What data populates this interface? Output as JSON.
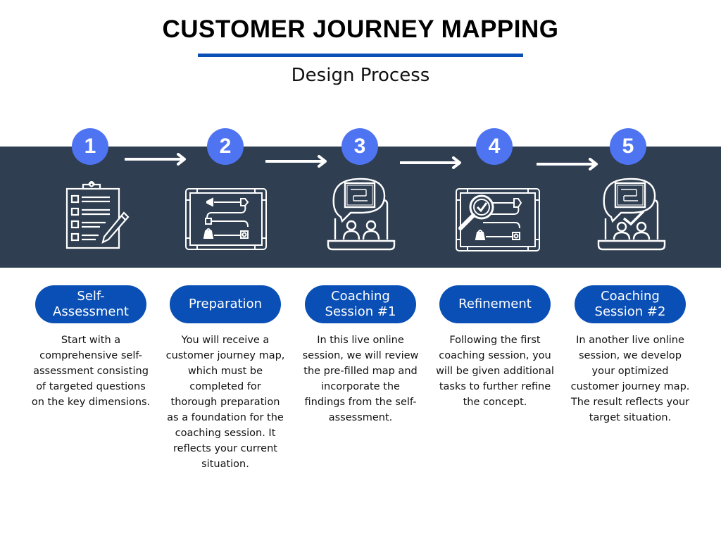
{
  "header": {
    "title": "CUSTOMER JOURNEY MAPPING",
    "subtitle": "Design Process"
  },
  "colors": {
    "accent_blue": "#0a4fb5",
    "step_circle": "#4f74f2",
    "band_background": "#2f3e50",
    "text": "#111111"
  },
  "steps": [
    {
      "number": "1",
      "icon": "clipboard-checklist-icon",
      "label": "Self- Assessment",
      "description": "Start with a comprehensive self-assessment consisting of targeted questions on the key dimensions."
    },
    {
      "number": "2",
      "icon": "journey-map-board-icon",
      "label": "Preparation",
      "description": "You will receive a customer journey map, which must be completed for thorough preparation as a foundation for the coaching session. It reflects your current situation."
    },
    {
      "number": "3",
      "icon": "online-coaching-session-icon",
      "label": "Coaching Session #1",
      "description": "In this live online session, we will review the pre-filled map and incorporate the findings from the self-assessment."
    },
    {
      "number": "4",
      "icon": "magnifier-check-map-icon",
      "label": "Refinement",
      "description": "Following the first coaching session, you will be given additional tasks to further refine the concept."
    },
    {
      "number": "5",
      "icon": "online-session-approved-icon",
      "label": "Coaching Session #2",
      "description": "In another live online session, we develop your optimized customer journey map. The result reflects your target situation."
    }
  ]
}
